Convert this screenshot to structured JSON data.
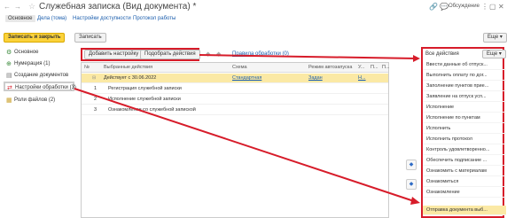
{
  "window": {
    "title": "Служебная записка (Вид документа) *",
    "discussion": "Обсуждение"
  },
  "tabs": [
    "Основное",
    "Дела (тома)",
    "Настройки доступности",
    "Протокол работы"
  ],
  "toolbar": {
    "save_close": "Записать и закрыть",
    "save": "Записать",
    "more": "Еще"
  },
  "sidebar": {
    "items": [
      {
        "label": "Основное",
        "icon": "gear-icon"
      },
      {
        "label": "Нумерация (1)",
        "icon": "numbering-icon"
      },
      {
        "label": "Создание документов",
        "icon": "document-icon"
      },
      {
        "label": "Настройки обработки (3)",
        "icon": "workflow-icon"
      },
      {
        "label": "Роли файлов (2)",
        "icon": "files-icon"
      }
    ]
  },
  "panel": {
    "add_setting": "Добавить настройку",
    "select_actions": "Подобрать действия",
    "processing_rules": "Правила обработки (0)"
  },
  "grid": {
    "headers": [
      "№",
      "Выбранные действия",
      "Схема",
      "Режим автозапуска",
      "У...",
      "П...",
      "П..."
    ],
    "rows": [
      {
        "num": "",
        "action": "Действует с 30.06.2022",
        "scheme": "Стандартная",
        "mode": "Задан",
        "u": "Н..."
      },
      {
        "num": "1",
        "action": "Регистрация служебной записки",
        "scheme": "",
        "mode": "",
        "u": ""
      },
      {
        "num": "2",
        "action": "Исполнение служебной записки",
        "scheme": "",
        "mode": "",
        "u": ""
      },
      {
        "num": "3",
        "action": "Ознакомление со служебной запиской",
        "scheme": "",
        "mode": "",
        "u": ""
      }
    ]
  },
  "right_panel": {
    "header": "Все действия",
    "more": "Еще",
    "items": [
      "Ввести данные об отпуск...",
      "Выполнить оплату по дог...",
      "Заполнение пунктов прие...",
      "Заявление на отпуск усп...",
      "Исполнение",
      "Исполнение по пунктам",
      "Исполнить",
      "Исполнить протокол",
      "Контроль удовлетворенно...",
      "Обеспечить подписание ...",
      "Ознакомить с материалам",
      "Ознакомиться",
      "Ознакомление",
      "Отправка документа выб..."
    ]
  },
  "colors": {
    "accent": "#fbd23a",
    "highlight": "#d71c2a",
    "link": "#1a5dad"
  }
}
